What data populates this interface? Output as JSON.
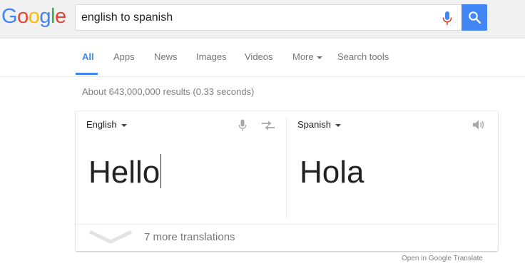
{
  "logo": {
    "letters": [
      {
        "char": "G",
        "color": "#4285f4"
      },
      {
        "char": "o",
        "color": "#ea4335"
      },
      {
        "char": "o",
        "color": "#fbbc05"
      },
      {
        "char": "g",
        "color": "#4285f4"
      },
      {
        "char": "l",
        "color": "#34a853"
      },
      {
        "char": "e",
        "color": "#ea4335"
      }
    ]
  },
  "search": {
    "value": "english to spanish",
    "mic_icon": "microphone-icon",
    "button_icon": "search-icon"
  },
  "nav": {
    "tabs": [
      {
        "label": "All",
        "active": true
      },
      {
        "label": "Apps",
        "active": false
      },
      {
        "label": "News",
        "active": false
      },
      {
        "label": "Images",
        "active": false
      },
      {
        "label": "Videos",
        "active": false
      },
      {
        "label": "More",
        "active": false
      },
      {
        "label": "Search tools",
        "active": false
      }
    ]
  },
  "results": {
    "stats": "About 643,000,000 results (0.33 seconds)"
  },
  "translate": {
    "source_language": "English",
    "target_language": "Spanish",
    "source_text": "Hello",
    "target_text": "Hola",
    "source_icons": [
      "microphone-icon",
      "swap-languages-icon"
    ],
    "target_icons": [
      "speaker-icon"
    ],
    "more_translations": "7 more translations",
    "open_link": "Open in Google Translate"
  },
  "colors": {
    "accent": "#4285f4",
    "topbar": "#f1f1f1",
    "mic_red": "#db4437"
  }
}
